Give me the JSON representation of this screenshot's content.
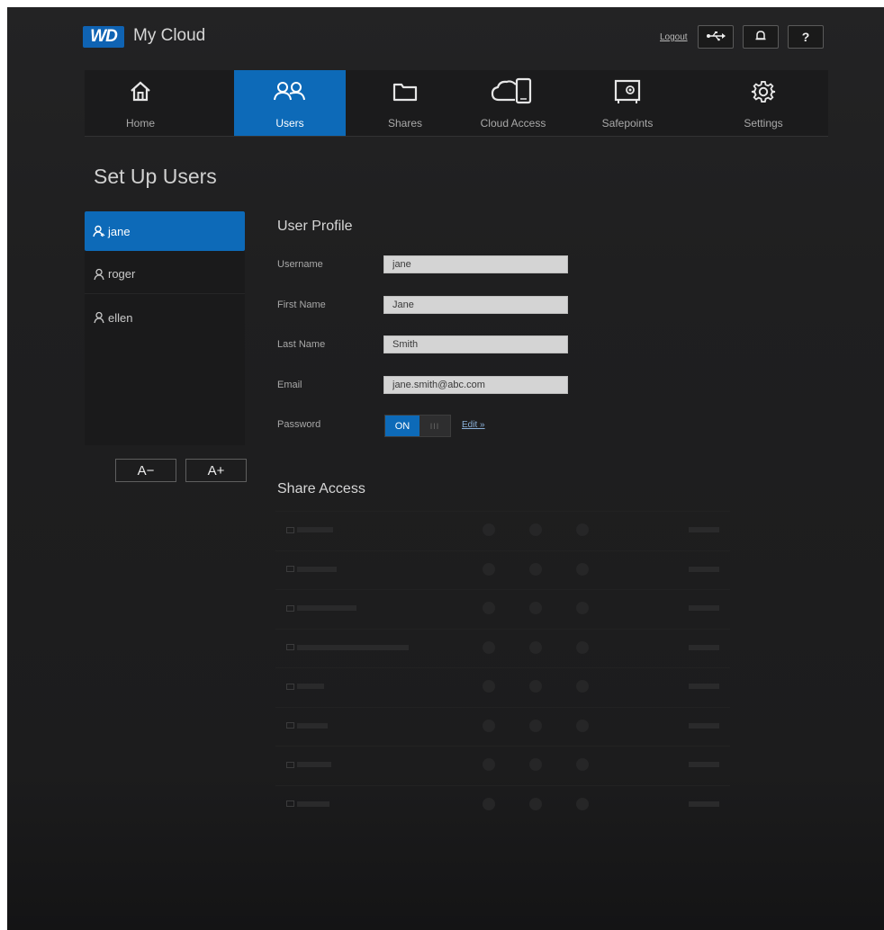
{
  "header": {
    "logo": "WD",
    "app_title": "My Cloud",
    "logout_label": "Logout",
    "usb_icon": "usb-icon",
    "alert_icon": "bell-icon",
    "help_label": "?"
  },
  "nav": {
    "items": [
      {
        "label": "Home",
        "icon": "home-icon"
      },
      {
        "label": "Users",
        "icon": "users-icon",
        "active": true
      },
      {
        "label": "Shares",
        "icon": "folder-icon"
      },
      {
        "label": "Cloud Access",
        "icon": "cloud-device-icon"
      },
      {
        "label": "Safepoints",
        "icon": "safe-icon"
      },
      {
        "label": "Settings",
        "icon": "gear-icon"
      }
    ]
  },
  "page": {
    "title": "Set Up Users"
  },
  "users": {
    "items": [
      {
        "name": "jane",
        "active": true
      },
      {
        "name": "roger"
      },
      {
        "name": "ellen"
      }
    ],
    "remove_label": "A−",
    "add_label": "A+"
  },
  "profile": {
    "title": "User Profile",
    "username_label": "Username",
    "username_value": "jane",
    "first_name_label": "First Name",
    "first_name_value": "Jane",
    "last_name_label": "Last Name",
    "last_name_value": "Smith",
    "email_label": "Email",
    "email_value": "jane.smith@abc.com",
    "password_label": "Password",
    "password_toggle_on": "ON",
    "password_toggle_off": "III",
    "edit_label": "Edit »"
  },
  "share_access": {
    "title": "Share Access",
    "row_count": 8,
    "accent_color": "#0d6ab8"
  }
}
